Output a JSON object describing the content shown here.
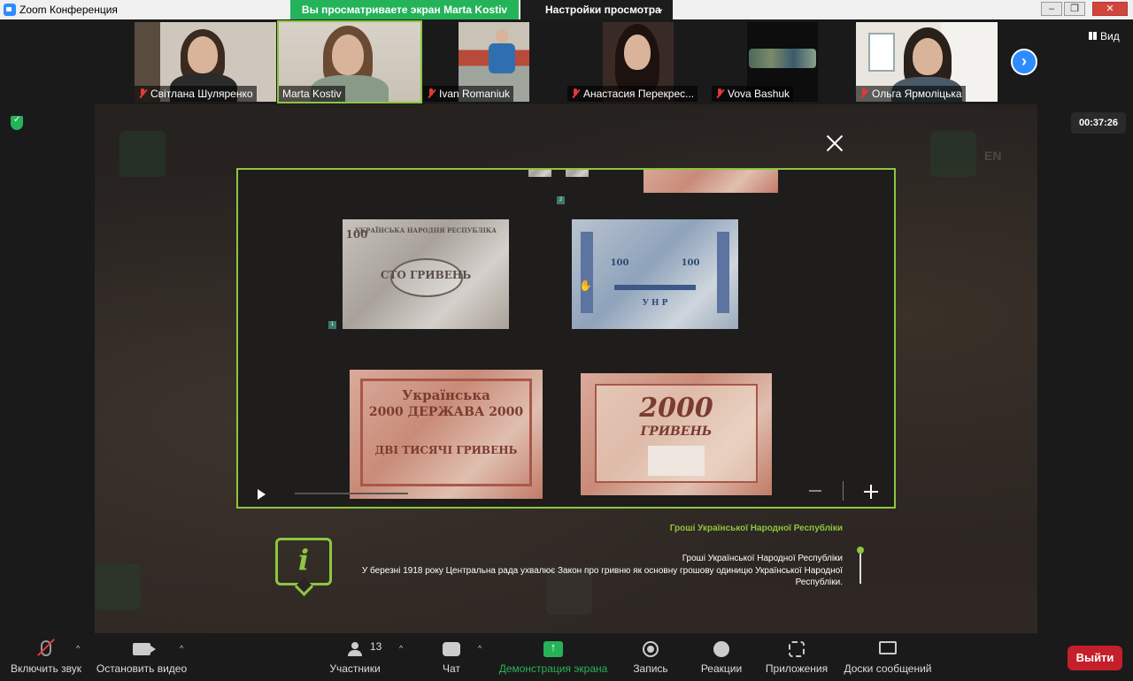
{
  "window": {
    "title": "Zoom Конференция",
    "share_banner": "Вы просматриваете экран Marta Kostiv",
    "view_options": "Настройки просмотра"
  },
  "gallery": {
    "participants": [
      {
        "name": "Світлана Шуляренко",
        "muted": true
      },
      {
        "name": "Marta Kostiv",
        "muted": false,
        "active": true
      },
      {
        "name": "Ivan Romaniuk",
        "muted": true
      },
      {
        "name": "Анастасия Перекрес...",
        "muted": true
      },
      {
        "name": "Vova Bashuk",
        "muted": true
      },
      {
        "name": "Ольга Ярмоліцька",
        "muted": true
      }
    ],
    "view_label": "Вид"
  },
  "meeting": {
    "timer": "00:37:26"
  },
  "shared_screen": {
    "ghost_en": "EN",
    "notes": {
      "note1_top": "УКРАЇНСЬКА НАРОДНЯ РЕСПУБЛІКА",
      "note1_mid": "СТО ГРИВЕНЬ",
      "note1_num": "100",
      "note2_num": "100",
      "note2_code": "У Н Р",
      "note3_top": "Українська",
      "note3_mid": "2000 ДЕРЖАВА 2000",
      "note3_bottom": "ДВІ ТИСЯЧІ ГРИВЕНЬ",
      "note4_num": "2000",
      "note4_sub": "ГРИВЕНЬ"
    },
    "markers": [
      "1",
      "2"
    ],
    "caption_title": "Гроші Української Народної Республіки",
    "caption_subtitle": "Гроші Української Народної Республіки",
    "caption_body": "У березні 1918 року Центральна рада ухвалює Закон про гривню як основну грошову одиницю Української Народної Республіки."
  },
  "toolbar": {
    "mute": "Включить звук",
    "video": "Остановить видео",
    "participants": "Участники",
    "participants_count": "13",
    "chat": "Чат",
    "share": "Демонстрация экрана",
    "record": "Запись",
    "reactions": "Реакции",
    "apps": "Приложения",
    "whiteboards": "Доски сообщений",
    "leave": "Выйти"
  },
  "colors": {
    "accent_green": "#8dc63f",
    "zoom_green": "#25b35a",
    "zoom_blue": "#2d8cff",
    "leave_red": "#c41f2a"
  }
}
